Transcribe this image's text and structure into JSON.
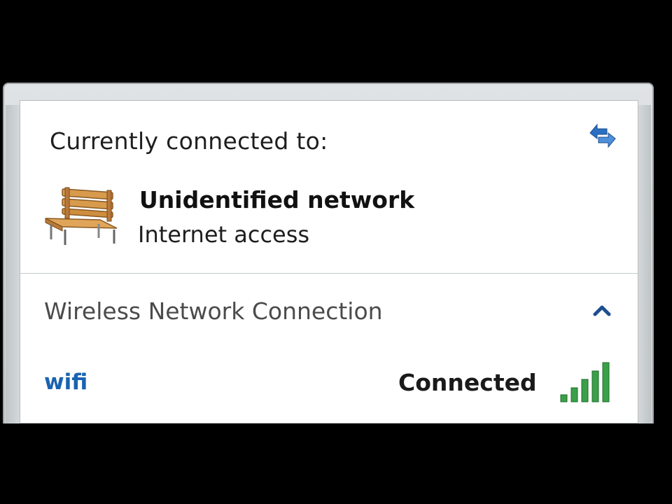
{
  "connection": {
    "heading": "Currently connected to:",
    "network_name": "Unidentified network",
    "network_status": "Internet access",
    "refresh_icon": "refresh-arrows-icon",
    "network_icon": "park-bench-icon"
  },
  "wireless_section": {
    "title": "Wireless Network Connection",
    "collapse_icon": "chevron-up-icon",
    "networks": [
      {
        "name": "wifi",
        "status": "Connected",
        "signal_icon": "signal-strength-icon",
        "signal_bars": 5
      }
    ]
  },
  "colors": {
    "link_blue": "#1a63b0",
    "signal_green": "#3aa04a",
    "chevron_blue": "#1e4f8f"
  }
}
